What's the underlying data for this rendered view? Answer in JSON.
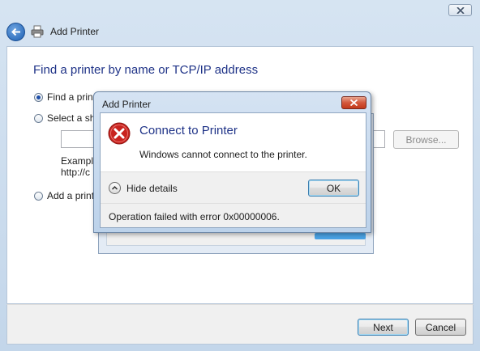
{
  "window": {
    "header_title": "Add Printer",
    "icons": {
      "back": "back-arrow-icon",
      "printer": "printer-icon",
      "close": "close-icon"
    }
  },
  "main": {
    "title": "Find a printer by name or TCP/IP address",
    "options": [
      {
        "label": "Find a print",
        "checked": true
      },
      {
        "label": "Select a sha",
        "checked": false
      },
      {
        "label": "Add a printe",
        "checked": false
      }
    ],
    "share_input_value": "",
    "browse_label": "Browse...",
    "example_line1": "Example",
    "example_line2": "http://c"
  },
  "footer": {
    "next_label": "Next",
    "cancel_label": "Cancel"
  },
  "dialog": {
    "title": "Add Printer",
    "heading": "Connect to Printer",
    "message": "Windows cannot connect to the printer.",
    "details_toggle_label": "Hide details",
    "ok_label": "OK",
    "details_text": "Operation failed with error 0x00000006.",
    "icons": {
      "error": "error-icon",
      "close": "close-icon",
      "toggle": "chevron-up-icon"
    },
    "colors": {
      "heading": "#1e3287",
      "error": "#c8231f"
    }
  }
}
